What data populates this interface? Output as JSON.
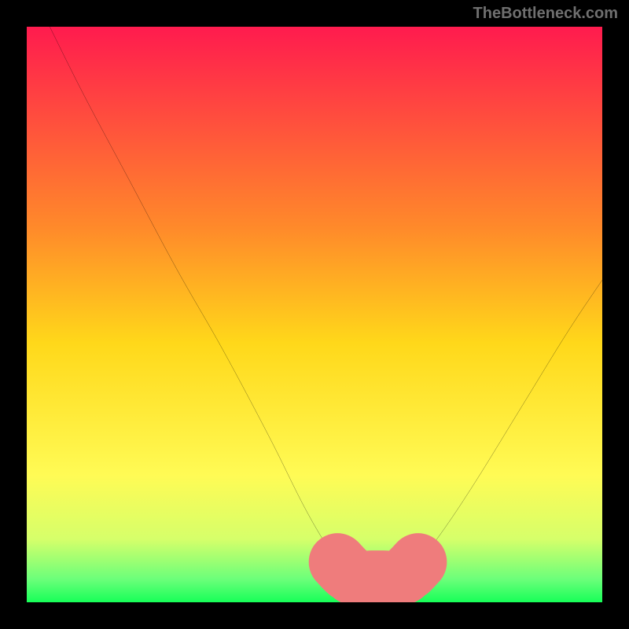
{
  "watermark": "TheBottleneck.com",
  "chart_data": {
    "type": "line",
    "title": "",
    "xlabel": "",
    "ylabel": "",
    "xlim": [
      0,
      100
    ],
    "ylim": [
      0,
      100
    ],
    "grid": false,
    "legend": false,
    "gradient_stops": [
      {
        "offset": 0,
        "color": "#ff1b4e"
      },
      {
        "offset": 35,
        "color": "#ff8a2a"
      },
      {
        "offset": 55,
        "color": "#ffd81a"
      },
      {
        "offset": 78,
        "color": "#fffb55"
      },
      {
        "offset": 89,
        "color": "#d6ff6a"
      },
      {
        "offset": 96,
        "color": "#6bff7a"
      },
      {
        "offset": 100,
        "color": "#17ff58"
      }
    ],
    "series": [
      {
        "name": "bottleneck-curve",
        "color": "#000000",
        "x": [
          4,
          10,
          18,
          26,
          34,
          42,
          48,
          52,
          54,
          56,
          58,
          60,
          62,
          64,
          66,
          68,
          72,
          78,
          86,
          94,
          100
        ],
        "y": [
          100,
          88,
          73,
          58,
          44,
          29,
          17,
          10,
          7,
          5,
          4,
          4,
          4,
          4,
          5,
          7,
          12,
          21,
          34,
          47,
          56
        ]
      },
      {
        "name": "optimal-zone",
        "color": "#ef7c7c",
        "style": "thick",
        "x": [
          54,
          56,
          58,
          60,
          62,
          64,
          66,
          68
        ],
        "y": [
          7,
          5,
          4,
          4,
          4,
          4,
          5,
          7
        ]
      }
    ]
  }
}
